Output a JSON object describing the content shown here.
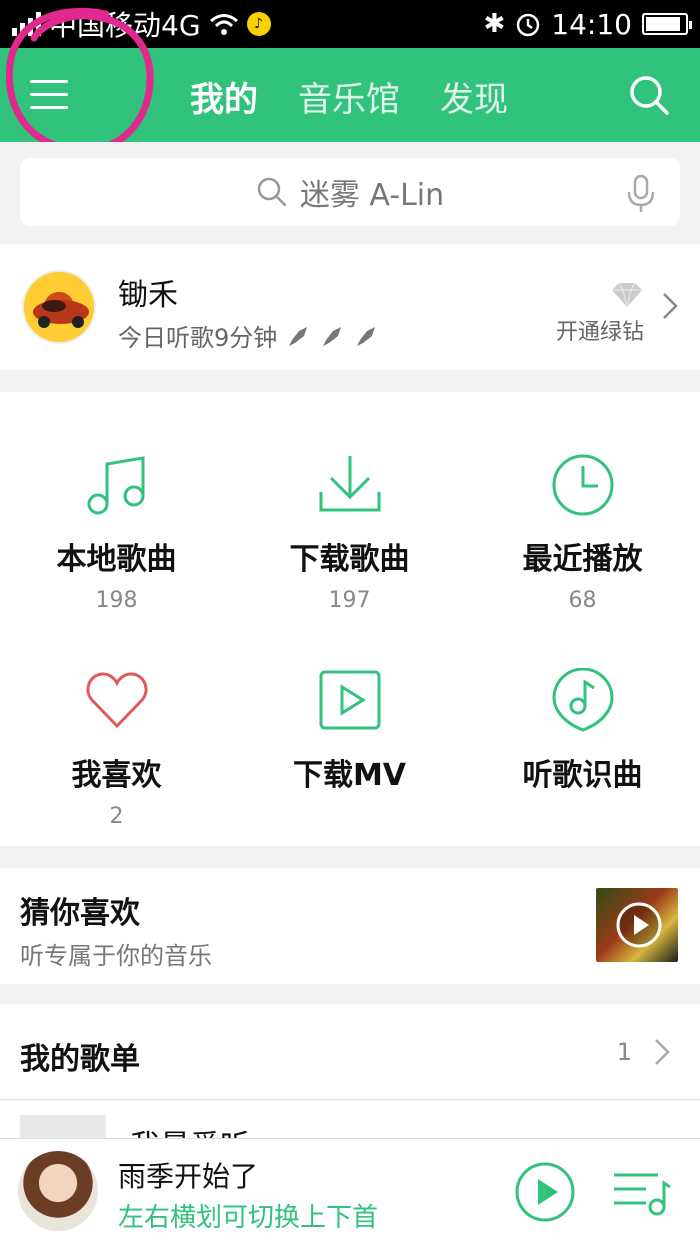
{
  "status_bar": {
    "carrier": "中国移动4G",
    "time": "14:10"
  },
  "header": {
    "tabs": [
      {
        "label": "我的",
        "active": true
      },
      {
        "label": "音乐馆",
        "active": false
      },
      {
        "label": "发现",
        "active": false
      }
    ]
  },
  "search": {
    "placeholder": "迷雾 A-Lin"
  },
  "profile": {
    "username": "锄禾",
    "listen_today": "今日听歌9分钟",
    "vip_label": "开通绿钻"
  },
  "grid": [
    {
      "label": "本地歌曲",
      "count": "198",
      "icon": "music-note-icon"
    },
    {
      "label": "下载歌曲",
      "count": "197",
      "icon": "download-icon"
    },
    {
      "label": "最近播放",
      "count": "68",
      "icon": "clock-icon"
    },
    {
      "label": "我喜欢",
      "count": "2",
      "icon": "heart-icon"
    },
    {
      "label": "下载MV",
      "count": "",
      "icon": "mv-play-icon"
    },
    {
      "label": "听歌识曲",
      "count": "",
      "icon": "song-recognition-icon"
    }
  ],
  "recommend": {
    "title": "猜你喜欢",
    "subtitle": "听专属于你的音乐"
  },
  "playlists": {
    "title": "我的歌单",
    "count": "1",
    "first_item_title": "我最爱听"
  },
  "player": {
    "song_title": "雨季开始了",
    "hint": "左右横划可切换上下首"
  },
  "colors": {
    "brand_green": "#31c27c",
    "heart_red": "#e05a5a",
    "annotation_pink": "#e0288f"
  }
}
